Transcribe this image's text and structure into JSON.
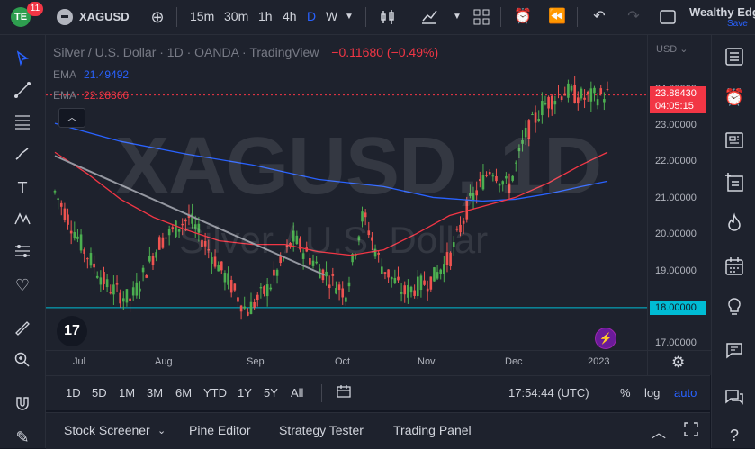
{
  "topbar": {
    "logo_text": "TE",
    "notifications": "11",
    "symbol": "XAGUSD",
    "intervals": [
      "15m",
      "30m",
      "1h",
      "4h",
      "D",
      "W"
    ],
    "active_interval": "D",
    "account": "Wealthy Edg",
    "save_label": "Save"
  },
  "legend": {
    "title": "Silver / U.S. Dollar · 1D · OANDA · TradingView",
    "change": "−0.11680 (−0.49%)",
    "ema_label": "EMA",
    "ema1": "21.49492",
    "ema2": "22.28866"
  },
  "watermark": {
    "symbol": "XAGUSD, 1D",
    "name": "Silver / U.S. Dollar"
  },
  "price_scale": {
    "currency": "USD",
    "ticks": [
      "24.00000",
      "23.00000",
      "22.00000",
      "21.00000",
      "20.00000",
      "19.00000",
      "18.00000",
      "17.00000"
    ],
    "last_price": "23.88430",
    "countdown": "04:05:15",
    "line_price": "18.00000"
  },
  "time_scale": {
    "ticks": [
      "Jul",
      "Aug",
      "Sep",
      "Oct",
      "Nov",
      "Dec",
      "2023"
    ]
  },
  "range_bar": {
    "ranges": [
      "1D",
      "5D",
      "1M",
      "3M",
      "6M",
      "YTD",
      "1Y",
      "5Y",
      "All"
    ],
    "clock": "17:54:44 (UTC)",
    "percent": "%",
    "log": "log",
    "auto": "auto"
  },
  "bottom_bar": {
    "tabs": [
      "Stock Screener",
      "Pine Editor",
      "Strategy Tester",
      "Trading Panel"
    ]
  },
  "colors": {
    "up": "#26a69a",
    "up_candle": "#4caf50",
    "down": "#ef5350",
    "ema_fast": "#2962ff",
    "ema_slow": "#f23645",
    "hline": "#00bcd4",
    "accent": "#2962ff"
  },
  "chart_data": {
    "type": "candlestick",
    "y_range": [
      16.8,
      24.6
    ],
    "current_price": 23.8843,
    "horizontal_line": 18.0,
    "trendline": [
      [
        0,
        22.2
      ],
      [
        82,
        18.9
      ]
    ],
    "ema_fast": [
      [
        0,
        23.1
      ],
      [
        20,
        22.6
      ],
      [
        40,
        22.25
      ],
      [
        60,
        21.95
      ],
      [
        80,
        21.55
      ],
      [
        100,
        21.35
      ],
      [
        115,
        21.05
      ],
      [
        130,
        20.95
      ],
      [
        140,
        21.0
      ],
      [
        150,
        21.15
      ],
      [
        160,
        21.35
      ],
      [
        168,
        21.5
      ]
    ],
    "ema_slow": [
      [
        0,
        22.3
      ],
      [
        10,
        21.7
      ],
      [
        20,
        21.0
      ],
      [
        30,
        20.5
      ],
      [
        40,
        20.15
      ],
      [
        50,
        19.85
      ],
      [
        60,
        19.75
      ],
      [
        70,
        19.75
      ],
      [
        80,
        19.55
      ],
      [
        90,
        19.45
      ],
      [
        100,
        19.6
      ],
      [
        110,
        20.05
      ],
      [
        120,
        20.55
      ],
      [
        130,
        20.8
      ],
      [
        140,
        21.05
      ],
      [
        150,
        21.45
      ],
      [
        160,
        21.95
      ],
      [
        168,
        22.3
      ]
    ]
  }
}
